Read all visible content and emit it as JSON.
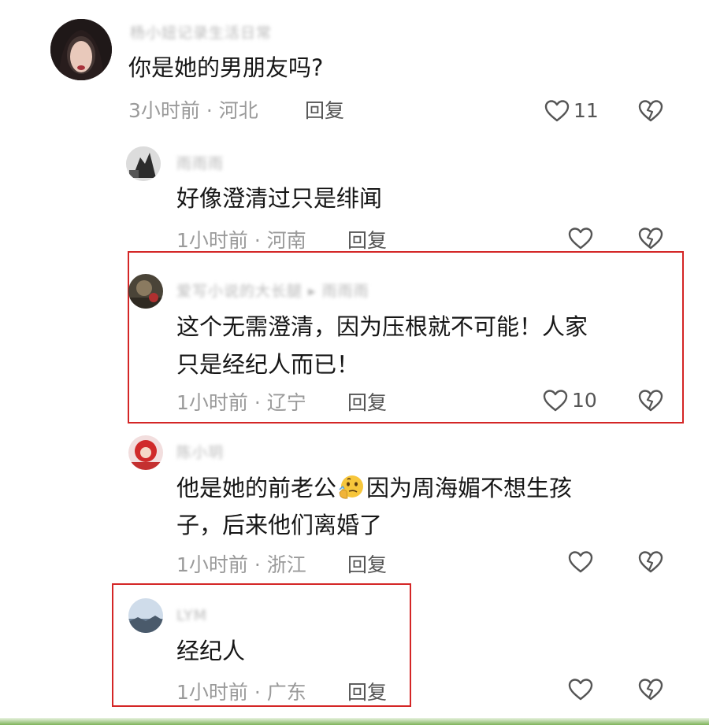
{
  "colors": {
    "highlight": "#d42626",
    "text": "#161616",
    "meta": "#9a9a9a",
    "icon": "#555555",
    "bottom_bar": "#7fb35a"
  },
  "comments": [
    {
      "username": "杨小妞记录生活日常",
      "text": "你是她的男朋友吗?",
      "time": "3小时前",
      "location": "河北",
      "reply_label": "回复",
      "likes": "11"
    },
    {
      "username": "雨雨雨",
      "text": "好像澄清过只是绯闻",
      "time": "1小时前",
      "location": "河南",
      "reply_label": "回复",
      "likes": ""
    },
    {
      "username": "爱写小说的大长腿",
      "reply_to": "雨雨雨",
      "text_line1": "这个无需澄清，因为压根就不可能！人家",
      "text_line2": "只是经纪人而已！",
      "time": "1小时前",
      "location": "辽宁",
      "reply_label": "回复",
      "likes": "10"
    },
    {
      "username": "陈小玥",
      "text_line1_a": "他是她的前老公",
      "emoji": "thinking-face-emoji",
      "text_line1_b": "因为周海媚不想生孩",
      "text_line2": "子，后来他们离婚了",
      "time": "1小时前",
      "location": "浙江",
      "reply_label": "回复",
      "likes": ""
    },
    {
      "username": "LYM",
      "text": "经纪人",
      "time": "1小时前",
      "location": "广东",
      "reply_label": "回复",
      "likes": ""
    }
  ],
  "separator": " · ",
  "icons": {
    "like": "heart-outline-icon",
    "dislike": "broken-heart-icon"
  }
}
